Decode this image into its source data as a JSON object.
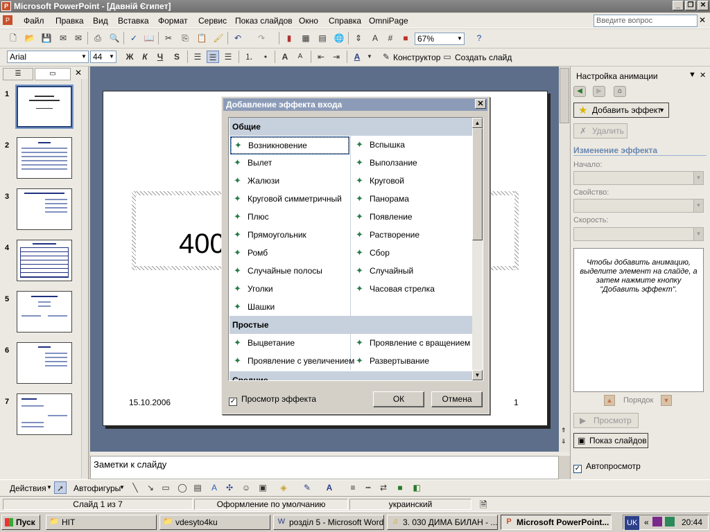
{
  "window": {
    "title": "Microsoft PowerPoint - [Давній Єгипет]",
    "app_icon_char": "P"
  },
  "menu": {
    "items": [
      "Файл",
      "Правка",
      "Вид",
      "Вставка",
      "Формат",
      "Сервис",
      "Показ слайдов",
      "Окно",
      "Справка",
      "OmniPage"
    ],
    "ask_placeholder": "Введите вопрос"
  },
  "toolbar1": {
    "zoom": "67%"
  },
  "toolbar2": {
    "font": "Arial",
    "size": "44",
    "bold": "Ж",
    "italic": "К",
    "underline": "Ч",
    "shadow": "S",
    "designer": "Конструктор",
    "new_slide": "Создать слайд",
    "font_color_letter": "A"
  },
  "slides": [
    {
      "num": "1"
    },
    {
      "num": "2"
    },
    {
      "num": "3"
    },
    {
      "num": "4"
    },
    {
      "num": "5"
    },
    {
      "num": "6"
    },
    {
      "num": "7"
    }
  ],
  "slide": {
    "big_text": "400",
    "date": "15.10.2006",
    "number": "1"
  },
  "notes": {
    "placeholder": "Заметки к слайду"
  },
  "taskpane": {
    "title": "Настройка анимации",
    "add_effect": "Добавить эффект",
    "delete": "Удалить",
    "change_header": "Изменение эффекта",
    "start_label": "Начало:",
    "property_label": "Свойство:",
    "speed_label": "Скорость:",
    "hint": "Чтобы добавить анимацию, выделите элемент на слайде, а затем нажмите кнопку \"Добавить эффект\".",
    "order_label": "Порядок",
    "preview": "Просмотр",
    "slideshow": "Показ слайдов",
    "autopreview": "Автопросмотр"
  },
  "dialog": {
    "title": "Добавление эффекта входа",
    "groups": [
      {
        "name": "Общие",
        "left": [
          "Возникновение",
          "Вылет",
          "Жалюзи",
          "Круговой симметричный",
          "Плюс",
          "Прямоугольник",
          "Ромб",
          "Случайные полосы",
          "Уголки",
          "Шашки"
        ],
        "right": [
          "Вспышка",
          "Выползание",
          "Круговой",
          "Панорама",
          "Появление",
          "Растворение",
          "Сбор",
          "Случайный",
          "Часовая стрелка"
        ]
      },
      {
        "name": "Простые",
        "left": [
          "Выцветание",
          "Проявление с увеличением"
        ],
        "right": [
          "Проявление с вращением",
          "Развертывание"
        ]
      },
      {
        "name": "Средние"
      }
    ],
    "preview_effect": "Просмотр эффекта",
    "ok": "ОК",
    "cancel": "Отмена"
  },
  "drawbar": {
    "actions": "Действия",
    "autoshapes": "Автофигуры"
  },
  "status": {
    "slide": "Слайд 1 из 7",
    "design": "Оформление по умолчанию",
    "lang": "украинский"
  },
  "taskbar": {
    "start": "Пуск",
    "tasks": [
      "HIT",
      "vdesyto4ku",
      "розділ 5 - Microsoft Word",
      "3. 030 ДИМА БИЛАН - ...",
      "Microsoft PowerPoint..."
    ],
    "lang": "UK",
    "clock": "20:44"
  }
}
